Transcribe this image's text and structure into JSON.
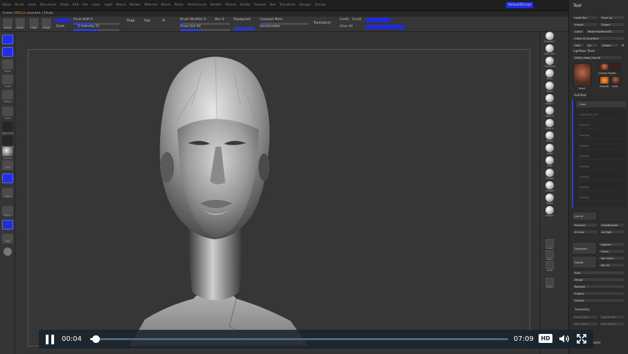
{
  "menu": {
    "items": [
      "Alpha",
      "Brush",
      "Color",
      "Document",
      "Draw",
      "Edit",
      "File",
      "Layer",
      "Light",
      "Macro",
      "Marker",
      "Material",
      "Movie",
      "Picker",
      "Preferences",
      "Render",
      "Stencil",
      "Stroke",
      "Texture",
      "Tool",
      "Transform",
      "Zplugin",
      "Zscript"
    ],
    "right_button": "DefaultZScript"
  },
  "title_strip": {
    "label": "Frame",
    "value": "108112",
    "suffix": "recorded. (7fsub)"
  },
  "toolbar": {
    "buttons": [
      "Actve",
      "Actvl",
      "Edit",
      "Draw"
    ],
    "zadd": "Zadd",
    "focal_label": "Focal Shift 0",
    "intensity_label": "Z Intensity 25",
    "rgb_labels": [
      "Mrgb",
      "Rgb",
      "M"
    ],
    "brush_mod_label": "Brush Modifier 0",
    "blur_label": "Blur 0",
    "replay_last": "ReplayLast",
    "draw_size_label": "Draw Size 64",
    "compact_mem": "Compact Mem",
    "backface_mask": "BackfaceMas",
    "topological": "Topological",
    "cont_labels": [
      "Cont1",
      "Cont2"
    ],
    "clear_all": "Clear All"
  },
  "left_shelf": {
    "labels": [
      "Move",
      "Scale",
      "Rotate",
      "Dots",
      "Alpha Off",
      "Texture Off",
      "MatCap Gray",
      "Poly",
      "Lsym",
      "Setup",
      "Edit"
    ]
  },
  "right_shelf": {
    "labels": [
      "Standard",
      "Dam_Std",
      "ClayBuild",
      "Pinch",
      "Move",
      "Move T",
      "Move E",
      "Move E",
      "Morph",
      "Inflat",
      "Blob",
      "Smooth",
      "Smooth",
      "Polish",
      "Flatten",
      "Frame",
      "Move",
      "Scale",
      "Rotate"
    ]
  },
  "tool_panel": {
    "title": "Tool",
    "buttons": [
      "Load Tool",
      "Save As",
      "Import",
      "Export",
      "Clone",
      "Make PolyMesh3D",
      "Clone All SubTools",
      "GoZ",
      "All",
      "Visible",
      "R"
    ],
    "lightbox": "Lightbox Tools",
    "tool_name": "2DSkl_Head_Old.48",
    "thumb_labels": [
      "Head",
      "Cylinder PolyMe",
      "SimpleB",
      "Head"
    ],
    "subtool_label": "SubTool",
    "subtool_rows": [
      "Head",
      "Head_EXP_002",
      "SubTool",
      "SubTool",
      "SubTool",
      "SubTool",
      "SubTool",
      "SubTool",
      "SubTool",
      "SubTool"
    ],
    "list_all": "List All",
    "rename": "Rename",
    "autoreorder": "AutoReorder",
    "all_low": "All Low",
    "all_high": "All High",
    "duplicate": "Duplicate",
    "append": "Append",
    "insert": "Insert",
    "delete": "Delete",
    "del_other": "Del Other",
    "del_all": "Del All",
    "split": "Split",
    "merge": "Merge",
    "remesh": "Remesh",
    "project": "Project",
    "extract": "Extract",
    "geometry": "Geometry",
    "geo_sub": [
      "Lower Res",
      "Higher Res",
      "Del Lower",
      "Del Higher"
    ],
    "bottom_label": "Sdiv",
    "bottom_label2": "ct Subdiv"
  },
  "player": {
    "current_time": "00:04",
    "duration": "07:09",
    "quality": "HD",
    "progress": 0.009
  }
}
